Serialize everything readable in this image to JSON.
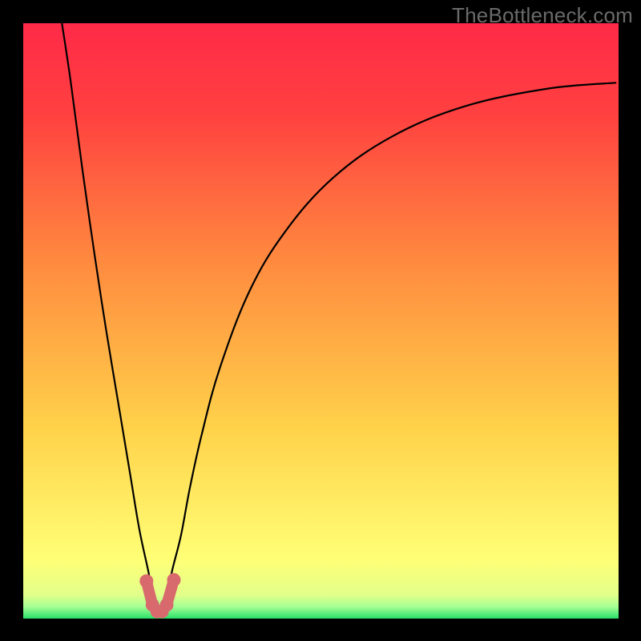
{
  "watermark": "TheBottleneck.com",
  "colors": {
    "frame": "#000000",
    "curve": "#000000",
    "marker": "#d86a6e",
    "good": "#29e06a",
    "light_good": "#a6ff94",
    "neutral": "#ffff76",
    "warn": "#ffd24a",
    "bad": "#ff2a48"
  },
  "chart_data": {
    "type": "line",
    "title": "",
    "xlabel": "",
    "ylabel": "",
    "xlim": [
      0,
      100
    ],
    "ylim": [
      0,
      100
    ],
    "note": "V-shaped bottleneck curve with minimum near x≈23. Background vertical gradient: green (bottom, y≈0–3) → warm mid-tones → red (top, y≈95–100). Coral markers trace the bottom of the V.",
    "gradient_stops": [
      {
        "offset": 0,
        "color": "#29e06a"
      },
      {
        "offset": 2,
        "color": "#a6ff94"
      },
      {
        "offset": 4,
        "color": "#e3ff8a"
      },
      {
        "offset": 10,
        "color": "#ffff76"
      },
      {
        "offset": 32,
        "color": "#ffd24a"
      },
      {
        "offset": 60,
        "color": "#ff8a3f"
      },
      {
        "offset": 85,
        "color": "#ff4040"
      },
      {
        "offset": 100,
        "color": "#ff2a48"
      }
    ],
    "series": [
      {
        "name": "bottleneck-curve",
        "x": [
          6.5,
          8,
          10,
          12,
          14,
          16,
          18,
          19.5,
          21,
          22,
          23,
          24,
          25,
          26.5,
          28,
          30,
          33,
          38,
          44,
          52,
          62,
          74,
          88,
          99.5
        ],
        "y": [
          100,
          90,
          75,
          61,
          48,
          36,
          24,
          15,
          8,
          3,
          1,
          3,
          8,
          14,
          22,
          31,
          42,
          55,
          65,
          74,
          81,
          86,
          89,
          90
        ],
        "color": "#000000"
      }
    ],
    "markers": {
      "name": "bottleneck-min-markers",
      "color": "#d86a6e",
      "points": [
        {
          "x": 20.7,
          "y": 6.3
        },
        {
          "x": 21.7,
          "y": 2.3
        },
        {
          "x": 22.5,
          "y": 1.2
        },
        {
          "x": 23.3,
          "y": 1.2
        },
        {
          "x": 24.1,
          "y": 2.3
        },
        {
          "x": 25.3,
          "y": 6.5
        }
      ]
    }
  }
}
